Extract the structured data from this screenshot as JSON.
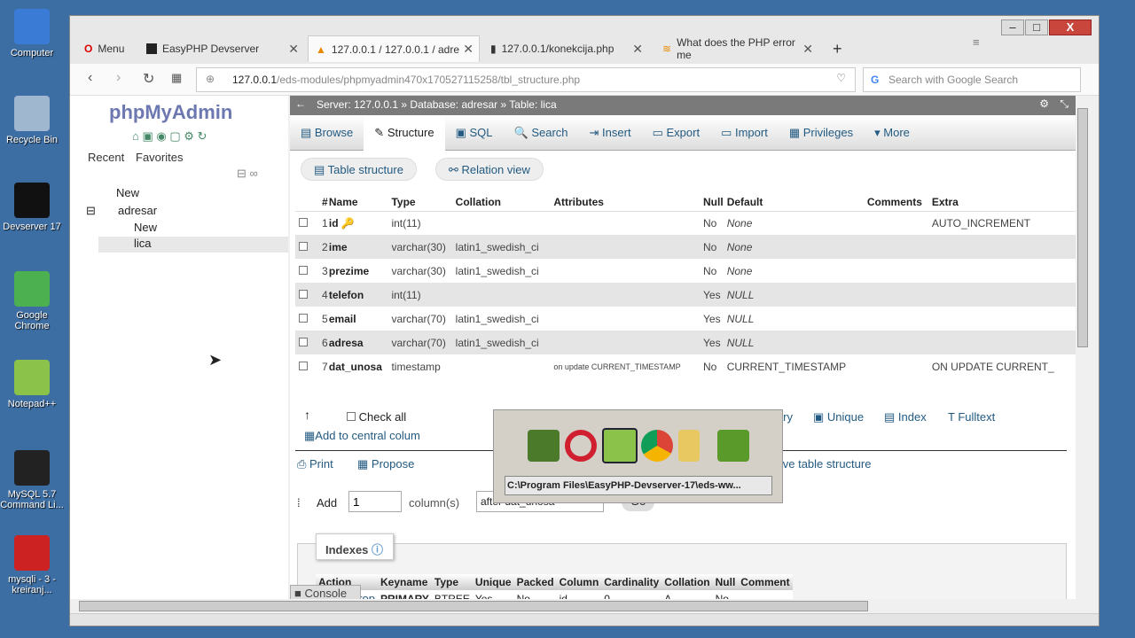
{
  "desktop": {
    "icons": [
      {
        "label": "Computer",
        "icon": "computer-icon",
        "color": "#3a7bd5"
      },
      {
        "label": "Recycle Bin",
        "icon": "recycle-bin-icon",
        "color": "#9fb8d0"
      },
      {
        "label": "Devserver 17",
        "icon": "easyphp-icon",
        "color": "#111111"
      },
      {
        "label": "Google Chrome",
        "icon": "chrome-icon",
        "color": "#4caf50"
      },
      {
        "label": "Notepad++",
        "icon": "notepadpp-icon",
        "color": "#8bc34a"
      },
      {
        "label": "MySQL 5.7 Command Li...",
        "icon": "mysql-icon",
        "color": "#222222"
      },
      {
        "label": "mysqli - 3 - kreiranj...",
        "icon": "video-icon",
        "color": "#cc2222"
      }
    ]
  },
  "browser": {
    "menu": "Menu",
    "tabs": [
      {
        "label": "EasyPHP Devserver"
      },
      {
        "label": "127.0.0.1 / 127.0.0.1 / adre"
      },
      {
        "label": "127.0.0.1/konekcija.php"
      },
      {
        "label": "What does the PHP error me"
      }
    ],
    "url_host": "127.0.0.1",
    "url_path": "/eds-modules/phpmyadmin470x170527115258/tbl_structure.php",
    "search_placeholder": "Search with Google Search"
  },
  "nav": {
    "logo": "phpMyAdmin",
    "recent": "Recent",
    "favorites": "Favorites",
    "tree": [
      {
        "label": "New"
      },
      {
        "label": "adresar"
      },
      {
        "label": "New"
      },
      {
        "label": "lica"
      }
    ]
  },
  "breadcrumb": {
    "server": "Server: 127.0.0.1",
    "database": "Database: adresar",
    "table": "Table: lica"
  },
  "menu_tabs": [
    "Browse",
    "Structure",
    "SQL",
    "Search",
    "Insert",
    "Export",
    "Import",
    "Privileges",
    "More"
  ],
  "subtabs": {
    "structure": "Table structure",
    "relation": "Relation view"
  },
  "structure": {
    "headers": [
      "#",
      "Name",
      "Type",
      "Collation",
      "Attributes",
      "Null",
      "Default",
      "Comments",
      "Extra"
    ],
    "rows": [
      [
        "1",
        "id",
        "int(11)",
        "",
        "",
        "No",
        "None",
        "",
        "AUTO_INCREMENT"
      ],
      [
        "2",
        "ime",
        "varchar(30)",
        "latin1_swedish_ci",
        "",
        "No",
        "None",
        "",
        ""
      ],
      [
        "3",
        "prezime",
        "varchar(30)",
        "latin1_swedish_ci",
        "",
        "No",
        "None",
        "",
        ""
      ],
      [
        "4",
        "telefon",
        "int(11)",
        "",
        "",
        "Yes",
        "NULL",
        "",
        ""
      ],
      [
        "5",
        "email",
        "varchar(70)",
        "latin1_swedish_ci",
        "",
        "Yes",
        "NULL",
        "",
        ""
      ],
      [
        "6",
        "adresa",
        "varchar(70)",
        "latin1_swedish_ci",
        "",
        "Yes",
        "NULL",
        "",
        ""
      ],
      [
        "7",
        "dat_unosa",
        "timestamp",
        "",
        "on update CURRENT_TIMESTAMP",
        "No",
        "CURRENT_TIMESTAMP",
        "",
        "ON UPDATE CURRENT_"
      ]
    ]
  },
  "actions": {
    "check_all": "Check all",
    "primary": "Primary",
    "unique": "Unique",
    "index": "Index",
    "fulltext": "Fulltext",
    "add_central": "Add to central colum",
    "print": "Print",
    "propose": "Propose",
    "improve": "Improve table structure",
    "add": "Add",
    "add_value": "1",
    "columns": "column(s)",
    "after": "after dat_unosa",
    "go": "Go"
  },
  "switcher": {
    "path": "C:\\Program Files\\EasyPHP-Devserver-17\\eds-ww..."
  },
  "indexes": {
    "title": "Indexes",
    "headers": [
      "Action",
      "Keyname",
      "Type",
      "Unique",
      "Packed",
      "Column",
      "Cardinality",
      "Collation",
      "Null",
      "Comment"
    ],
    "row": {
      "edit": "Edit",
      "drop": "Drop",
      "cells": [
        "PRIMARY",
        "BTREE",
        "Yes",
        "No",
        "id",
        "0",
        "A",
        "No",
        ""
      ]
    }
  },
  "console": "Console"
}
